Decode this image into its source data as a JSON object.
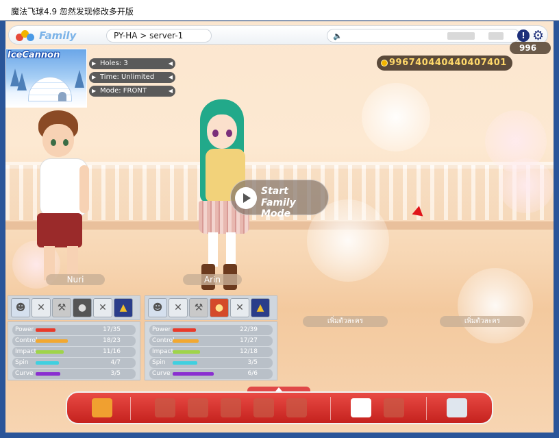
{
  "window": {
    "title": "魔法飞球4.9 忽然发现修改多开版"
  },
  "topbar": {
    "mode_label": "Family",
    "server": "PY-HA > server-1",
    "chat_icon": "speaker-icon",
    "alert_glyph": "!",
    "settings_icon": "gear-icon"
  },
  "currency": {
    "small_amount": "996",
    "amount": "996740440440407401"
  },
  "course": {
    "name": "IceCannon",
    "holes": "Holes: 3",
    "time": "Time: Unlimited",
    "mode": "Mode: FRONT"
  },
  "start": {
    "line1": "Start",
    "line2": "Family Mode"
  },
  "players": [
    {
      "name": "Nuri",
      "stats": [
        {
          "label": "Power",
          "value": "17/35",
          "ratio": 0.486,
          "color": "#e83a2a"
        },
        {
          "label": "Control",
          "value": "18/23",
          "ratio": 0.783,
          "color": "#f2a830"
        },
        {
          "label": "Impact",
          "value": "11/16",
          "ratio": 0.688,
          "color": "#9fd44a"
        },
        {
          "label": "Spin",
          "value": "4/7",
          "ratio": 0.571,
          "color": "#3fd0e0"
        },
        {
          "label": "Curve",
          "value": "3/5",
          "ratio": 0.6,
          "color": "#8a2fd0"
        }
      ]
    },
    {
      "name": "Arin",
      "stats": [
        {
          "label": "Power",
          "value": "22/39",
          "ratio": 0.564,
          "color": "#e83a2a"
        },
        {
          "label": "Control",
          "value": "17/27",
          "ratio": 0.63,
          "color": "#f2a830"
        },
        {
          "label": "Impact",
          "value": "12/18",
          "ratio": 0.667,
          "color": "#9fd44a"
        },
        {
          "label": "Spin",
          "value": "3/5",
          "ratio": 0.6,
          "color": "#3fd0e0"
        },
        {
          "label": "Curve",
          "value": "6/6",
          "ratio": 1.0,
          "color": "#8a2fd0"
        }
      ]
    }
  ],
  "add_character": {
    "slot3": "เพิ่มตัวละคร",
    "slot4": "เพิ่มตัวละคร"
  }
}
